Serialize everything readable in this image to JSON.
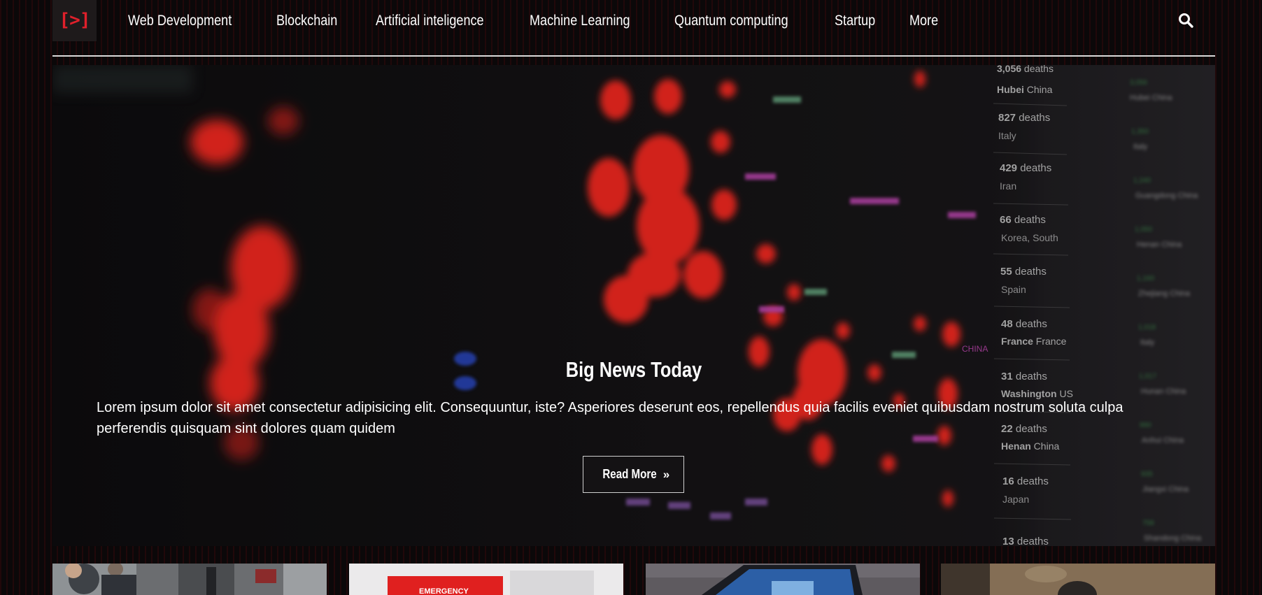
{
  "logo": {
    "text": "[>]"
  },
  "nav": {
    "items": [
      "Web Development",
      "Blockchain",
      "Artificial inteligence",
      "Machine Learning",
      "Quantum computing",
      "Startup",
      "More"
    ],
    "search_icon": "search-icon"
  },
  "hero": {
    "title": "Big News Today",
    "text": "Lorem ipsum dolor sit amet consectetur adipisicing elit. Consequuntur, iste? Asperiores deserunt eos, repellendus quia facilis eveniet quibusdam nostrum soluta culpa perferendis quisquam sint dolores quam quidem",
    "button_label": "Read More",
    "button_icon": "double-chevron-right-icon",
    "map_labels": [
      {
        "num": "3,056",
        "word": "deaths",
        "place": "Hubei China"
      },
      {
        "num": "827",
        "word": "deaths",
        "place": "Italy"
      },
      {
        "num": "429",
        "word": "deaths",
        "place": "Iran"
      },
      {
        "num": "66",
        "word": "deaths",
        "place": "Korea, South"
      },
      {
        "num": "55",
        "word": "deaths",
        "place": "Spain"
      },
      {
        "num": "48",
        "word": "deaths",
        "place": "France France"
      },
      {
        "num": "31",
        "word": "deaths",
        "place": "Washington US"
      },
      {
        "num": "22",
        "word": "deaths",
        "place": "Henan China"
      },
      {
        "num": "16",
        "word": "deaths",
        "place": "Japan"
      },
      {
        "num": "13",
        "word": "deaths",
        "place": ""
      }
    ],
    "map_tag": "CHINA"
  },
  "thumbnails": [
    {
      "name": "thumbnail-1"
    },
    {
      "name": "thumbnail-2",
      "text": "EMERGENCY"
    },
    {
      "name": "thumbnail-3"
    },
    {
      "name": "thumbnail-4"
    }
  ],
  "colors": {
    "accent": "#e0202b",
    "background": "#0b0809",
    "text": "#ffffff"
  }
}
